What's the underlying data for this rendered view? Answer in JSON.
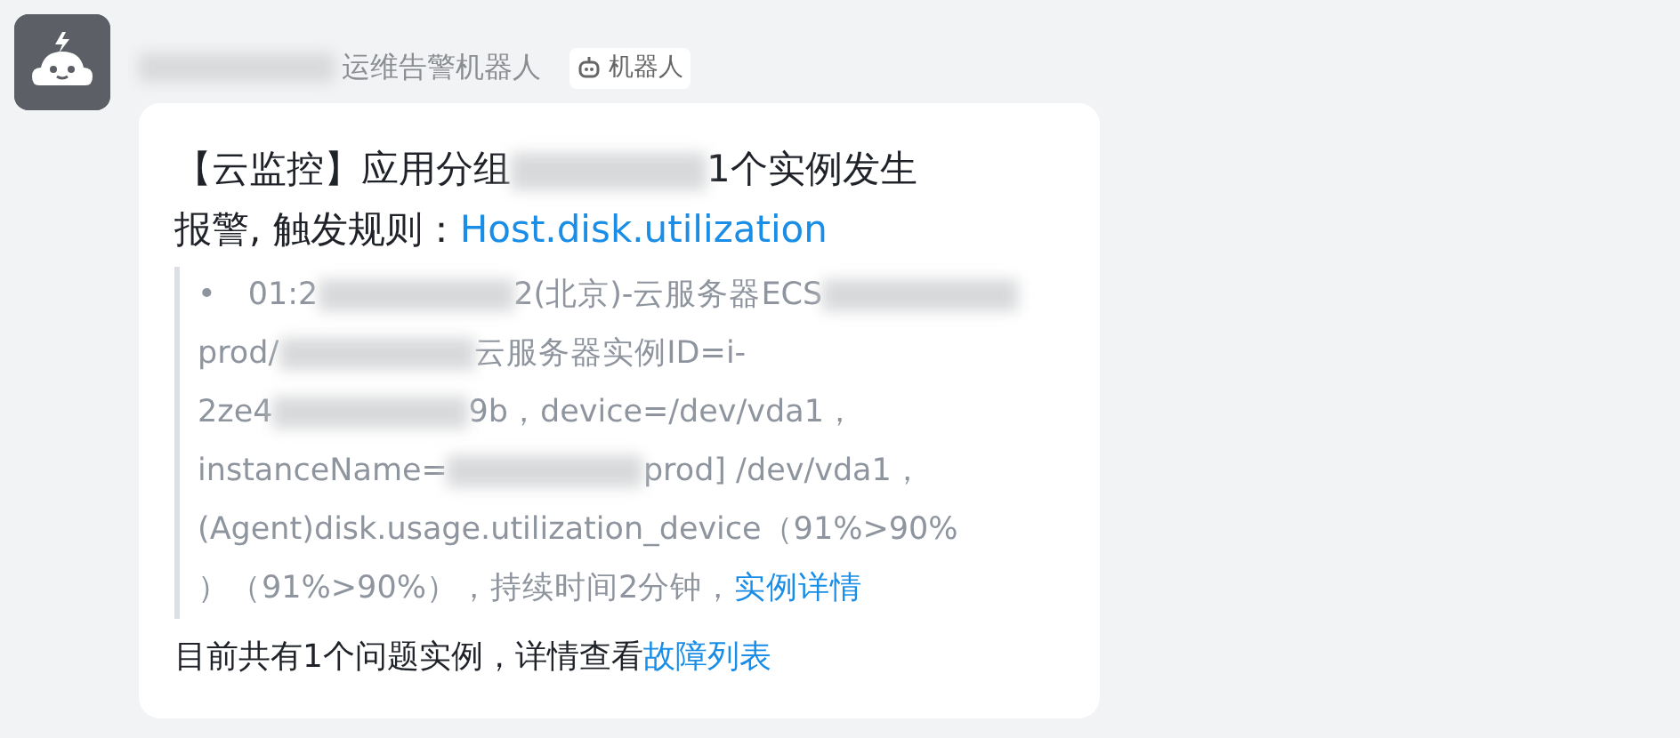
{
  "sender": {
    "name": [
      {
        "kind": "redacted"
      },
      {
        "kind": "text",
        "text": "运维告警机器人"
      }
    ],
    "badge": "机器人"
  },
  "message": {
    "heading": [
      [
        {
          "kind": "text",
          "text": "【云监控】应用分组"
        },
        {
          "kind": "redacted"
        },
        {
          "kind": "text",
          "text": "1个实例发生"
        }
      ],
      [
        {
          "kind": "text",
          "text": "报警, 触发规则："
        },
        {
          "kind": "link",
          "text": "Host.disk.utilization"
        }
      ]
    ],
    "quote": [
      [
        {
          "kind": "bullet",
          "text": "•"
        },
        {
          "kind": "text",
          "text": "01:2"
        },
        {
          "kind": "redacted"
        },
        {
          "kind": "text",
          "text": "2(北京)-云服务器ECS"
        },
        {
          "kind": "redacted"
        }
      ],
      [
        {
          "kind": "text",
          "text": "prod/"
        },
        {
          "kind": "redacted"
        },
        {
          "kind": "text",
          "text": "云服务器实例ID=i-"
        }
      ],
      [
        {
          "kind": "text",
          "text": "2ze4"
        },
        {
          "kind": "redacted"
        },
        {
          "kind": "text",
          "text": "9b，device=/dev/vda1，"
        }
      ],
      [
        {
          "kind": "text",
          "text": "instanceName="
        },
        {
          "kind": "redacted"
        },
        {
          "kind": "text",
          "text": "prod] /dev/vda1，"
        }
      ],
      [
        {
          "kind": "text",
          "text": "(Agent)disk.usage.utilization_device（91%>90%"
        }
      ],
      [
        {
          "kind": "text",
          "text": "）（91%>90%），持续时间2分钟，"
        },
        {
          "kind": "link",
          "text": "实例详情"
        }
      ]
    ],
    "footer": [
      {
        "kind": "text",
        "text": "目前共有1个问题实例，详情查看"
      },
      {
        "kind": "link",
        "text": "故障列表"
      }
    ]
  }
}
